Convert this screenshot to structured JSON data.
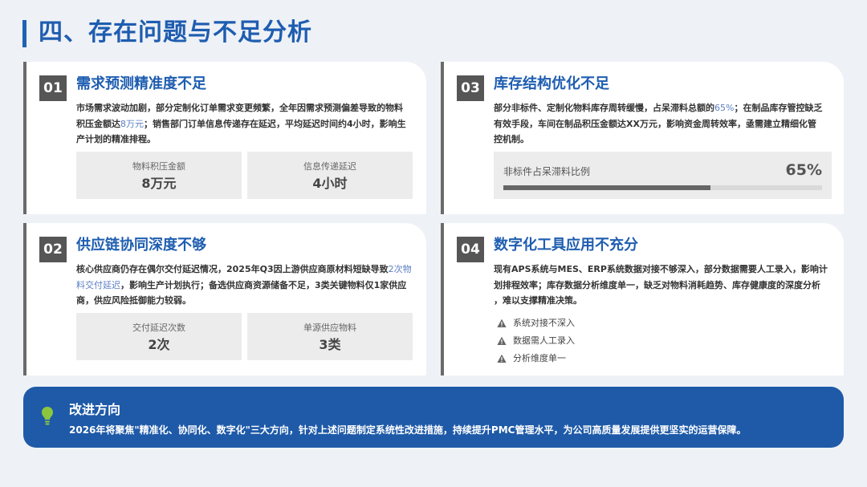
{
  "page_title": "四、存在问题与不足分析",
  "cards": [
    {
      "num": "01",
      "title": "需求预测精准度不足",
      "desc_lines": [
        {
          "pre": "市场需求波动加剧，部分定制化订单需求变更频繁，全年因需求预测偏差导致的物料",
          "hl": "",
          "post": ""
        },
        {
          "pre": "积压金额达",
          "hl": "8万元",
          "post": "；销售部门订单信息传递存在延迟，平均延迟时间约4小时，影响生"
        },
        {
          "pre": "产计划的精准排程。",
          "hl": "",
          "post": ""
        }
      ],
      "metrics": [
        {
          "label": "物料积压金额",
          "value": "8万元"
        },
        {
          "label": "信息传递延迟",
          "value": "4小时"
        }
      ]
    },
    {
      "num": "02",
      "title": "供应链协同深度不够",
      "desc_lines": [
        {
          "pre": "核心供应商仍存在偶尔交付延迟情况，2025年Q3因上游供应商原材料短缺导致",
          "hl": "2次物",
          "post": ""
        },
        {
          "pre": "",
          "hl": "料交付延迟",
          "post": "，影响生产计划执行；备选供应商资源储备不足，3类关键物料仅1家供应"
        },
        {
          "pre": "商，供应风险抵御能力较弱。",
          "hl": "",
          "post": ""
        }
      ],
      "metrics": [
        {
          "label": "交付延迟次数",
          "value": "2次"
        },
        {
          "label": "单源供应物料",
          "value": "3类"
        }
      ]
    },
    {
      "num": "03",
      "title": "库存结构优化不足",
      "desc_lines": [
        {
          "pre": "部分非标件、定制化物料库存周转缓慢，占呆滞料总额的",
          "hl": "65%",
          "post": "；在制品库存管控缺乏"
        },
        {
          "pre": "有效手段，车间在制品积压金额达XX万元，影响资金周转效率，亟需建立精细化管",
          "hl": "",
          "post": ""
        },
        {
          "pre": "控机制。",
          "hl": "",
          "post": ""
        }
      ],
      "progress": {
        "label": "非标件占呆滞料比例",
        "value_text": "65%",
        "fraction": 0.65
      }
    },
    {
      "num": "04",
      "title": "数字化工具应用不充分",
      "desc_lines": [
        {
          "pre": "现有APS系统与MES、ERP系统数据对接不够深入，部分数据需要人工录入，影响计",
          "hl": "",
          "post": ""
        },
        {
          "pre": "划排程效率；库存数据分析维度单一，缺乏对物料消耗趋势、库存健康度的深度分析",
          "hl": "",
          "post": ""
        },
        {
          "pre": "，难以支撑精准决策。",
          "hl": "",
          "post": ""
        }
      ],
      "issues": [
        "系统对接不深入",
        "数据需人工录入",
        "分析维度单一"
      ]
    }
  ],
  "banner": {
    "title": "改进方向",
    "text": "2026年将聚焦\"精准化、协同化、数字化\"三大方向，针对上述问题制定系统性改进措施，持续提升PMC管理水平，为公司高质量发展提供更坚实的运营保障。"
  },
  "colors": {
    "accent": "#1e5db0",
    "banner": "#1e5aa8",
    "number_badge": "#565656",
    "highlight": "#5b7fc4",
    "bulb": "#8cc63f"
  },
  "icons": {
    "issue": "warning-triangle-icon",
    "banner": "lightbulb-icon"
  }
}
